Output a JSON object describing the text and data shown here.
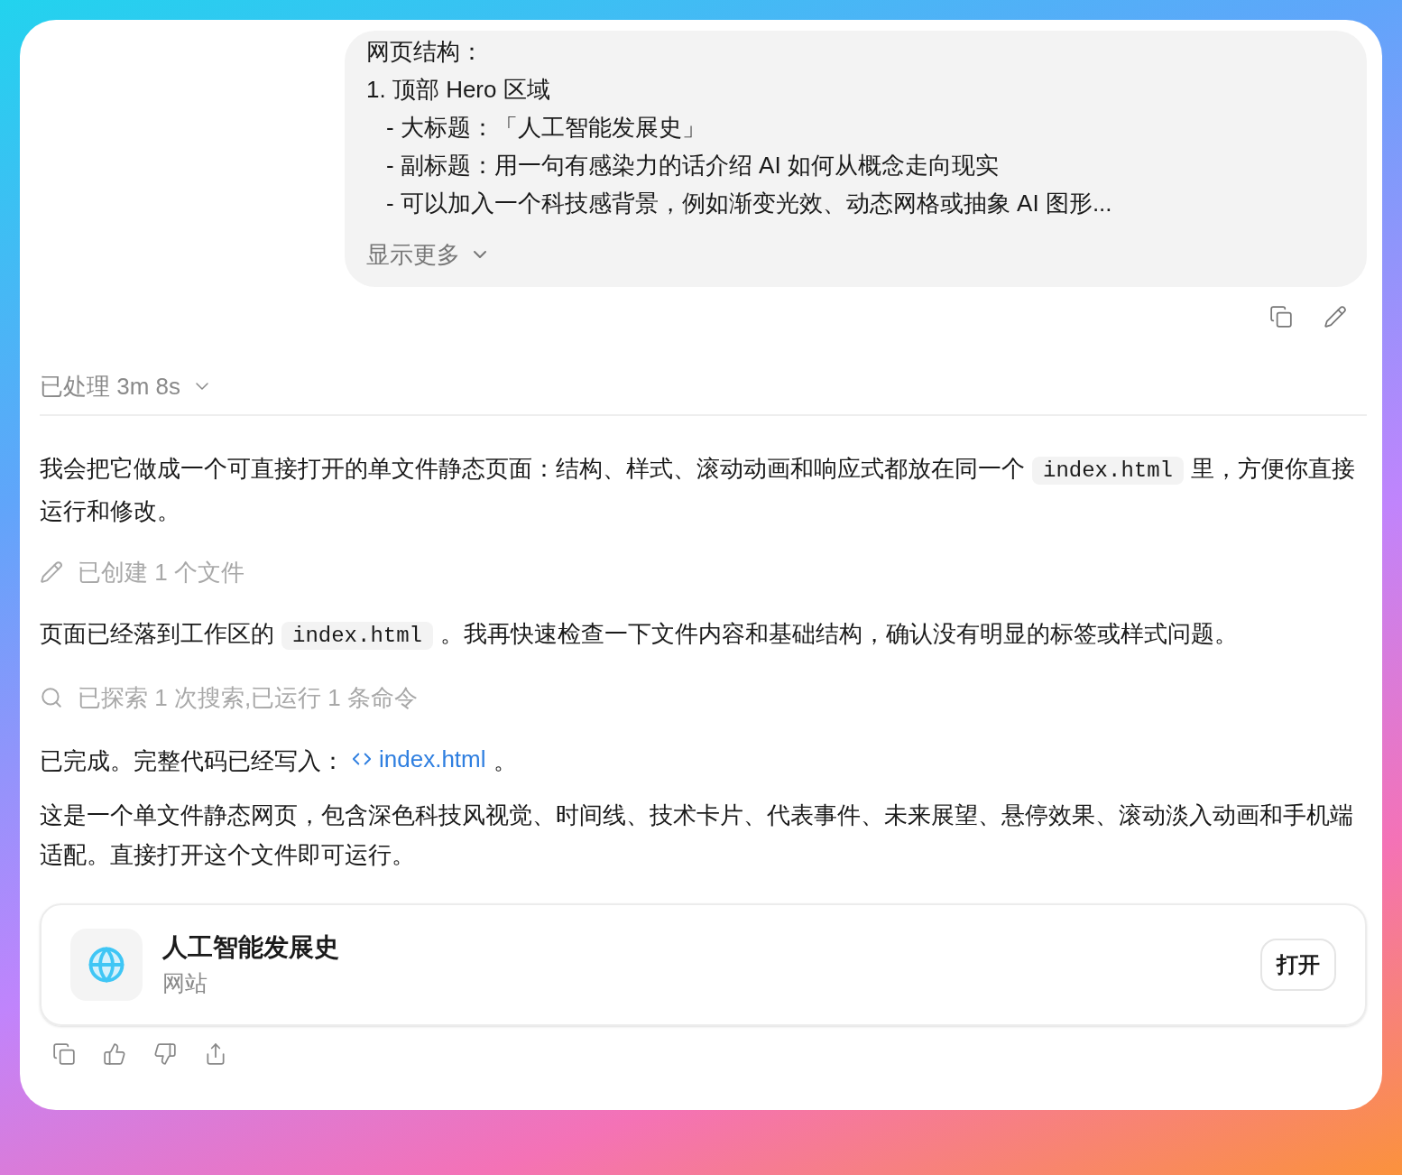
{
  "user_message": {
    "lines": [
      {
        "text": "网页结构："
      },
      {
        "text": "1. 顶部 Hero 区域",
        "children": [
          {
            "text": "- 大标题：「人工智能发展史」"
          },
          {
            "text": "- 副标题：用一句有感染力的话介绍 AI 如何从概念走向现实"
          },
          {
            "text": "- 可以加入一个科技感背景，例如渐变光效、动态网格或抽象 AI 图形..."
          }
        ]
      }
    ],
    "show_more": "显示更多",
    "expanded": false
  },
  "processed": {
    "label": "已处理 3m 8s",
    "expanded": false
  },
  "transcript": [
    {
      "kind": "paragraph",
      "segments": [
        {
          "kind": "text",
          "text": "我会把它做成一个可直接打开的单文件静态页面：结构、样式、滚动动画和响应式都放在同一个"
        },
        {
          "kind": "code",
          "text": "index.html"
        },
        {
          "kind": "text",
          "text": "里，方便你直接运行和修改。"
        }
      ]
    },
    {
      "kind": "file_activity",
      "text": "已创建 1 个文件"
    },
    {
      "kind": "paragraph",
      "segments": [
        {
          "kind": "text",
          "text": "页面已经落到工作区的"
        },
        {
          "kind": "code",
          "text": "index.html"
        },
        {
          "kind": "text",
          "text": "。我再快速检查一下文件内容和基础结构，确认没有明显的标签或样式问题。"
        }
      ]
    },
    {
      "kind": "search_activity",
      "text": "已探索 1 次搜索,已运行 1 条命令"
    },
    {
      "kind": "paragraph",
      "segments": [
        {
          "kind": "text",
          "text": "已完成。完整代码已经写入："
        },
        {
          "kind": "link",
          "text": "index.html"
        },
        {
          "kind": "text",
          "text": "。"
        }
      ]
    },
    {
      "kind": "paragraph",
      "segments": [
        {
          "kind": "text",
          "text": "这是一个单文件静态网页，包含深色科技风视觉、时间线、技术卡片、代表事件、未来展望、悬停效果、滚动淡入动画和手机端适配。直接打开这个文件即可运行。"
        }
      ]
    }
  ],
  "artifact": {
    "title": "人工智能发展史",
    "subtitle": "网站",
    "button": "打开"
  }
}
